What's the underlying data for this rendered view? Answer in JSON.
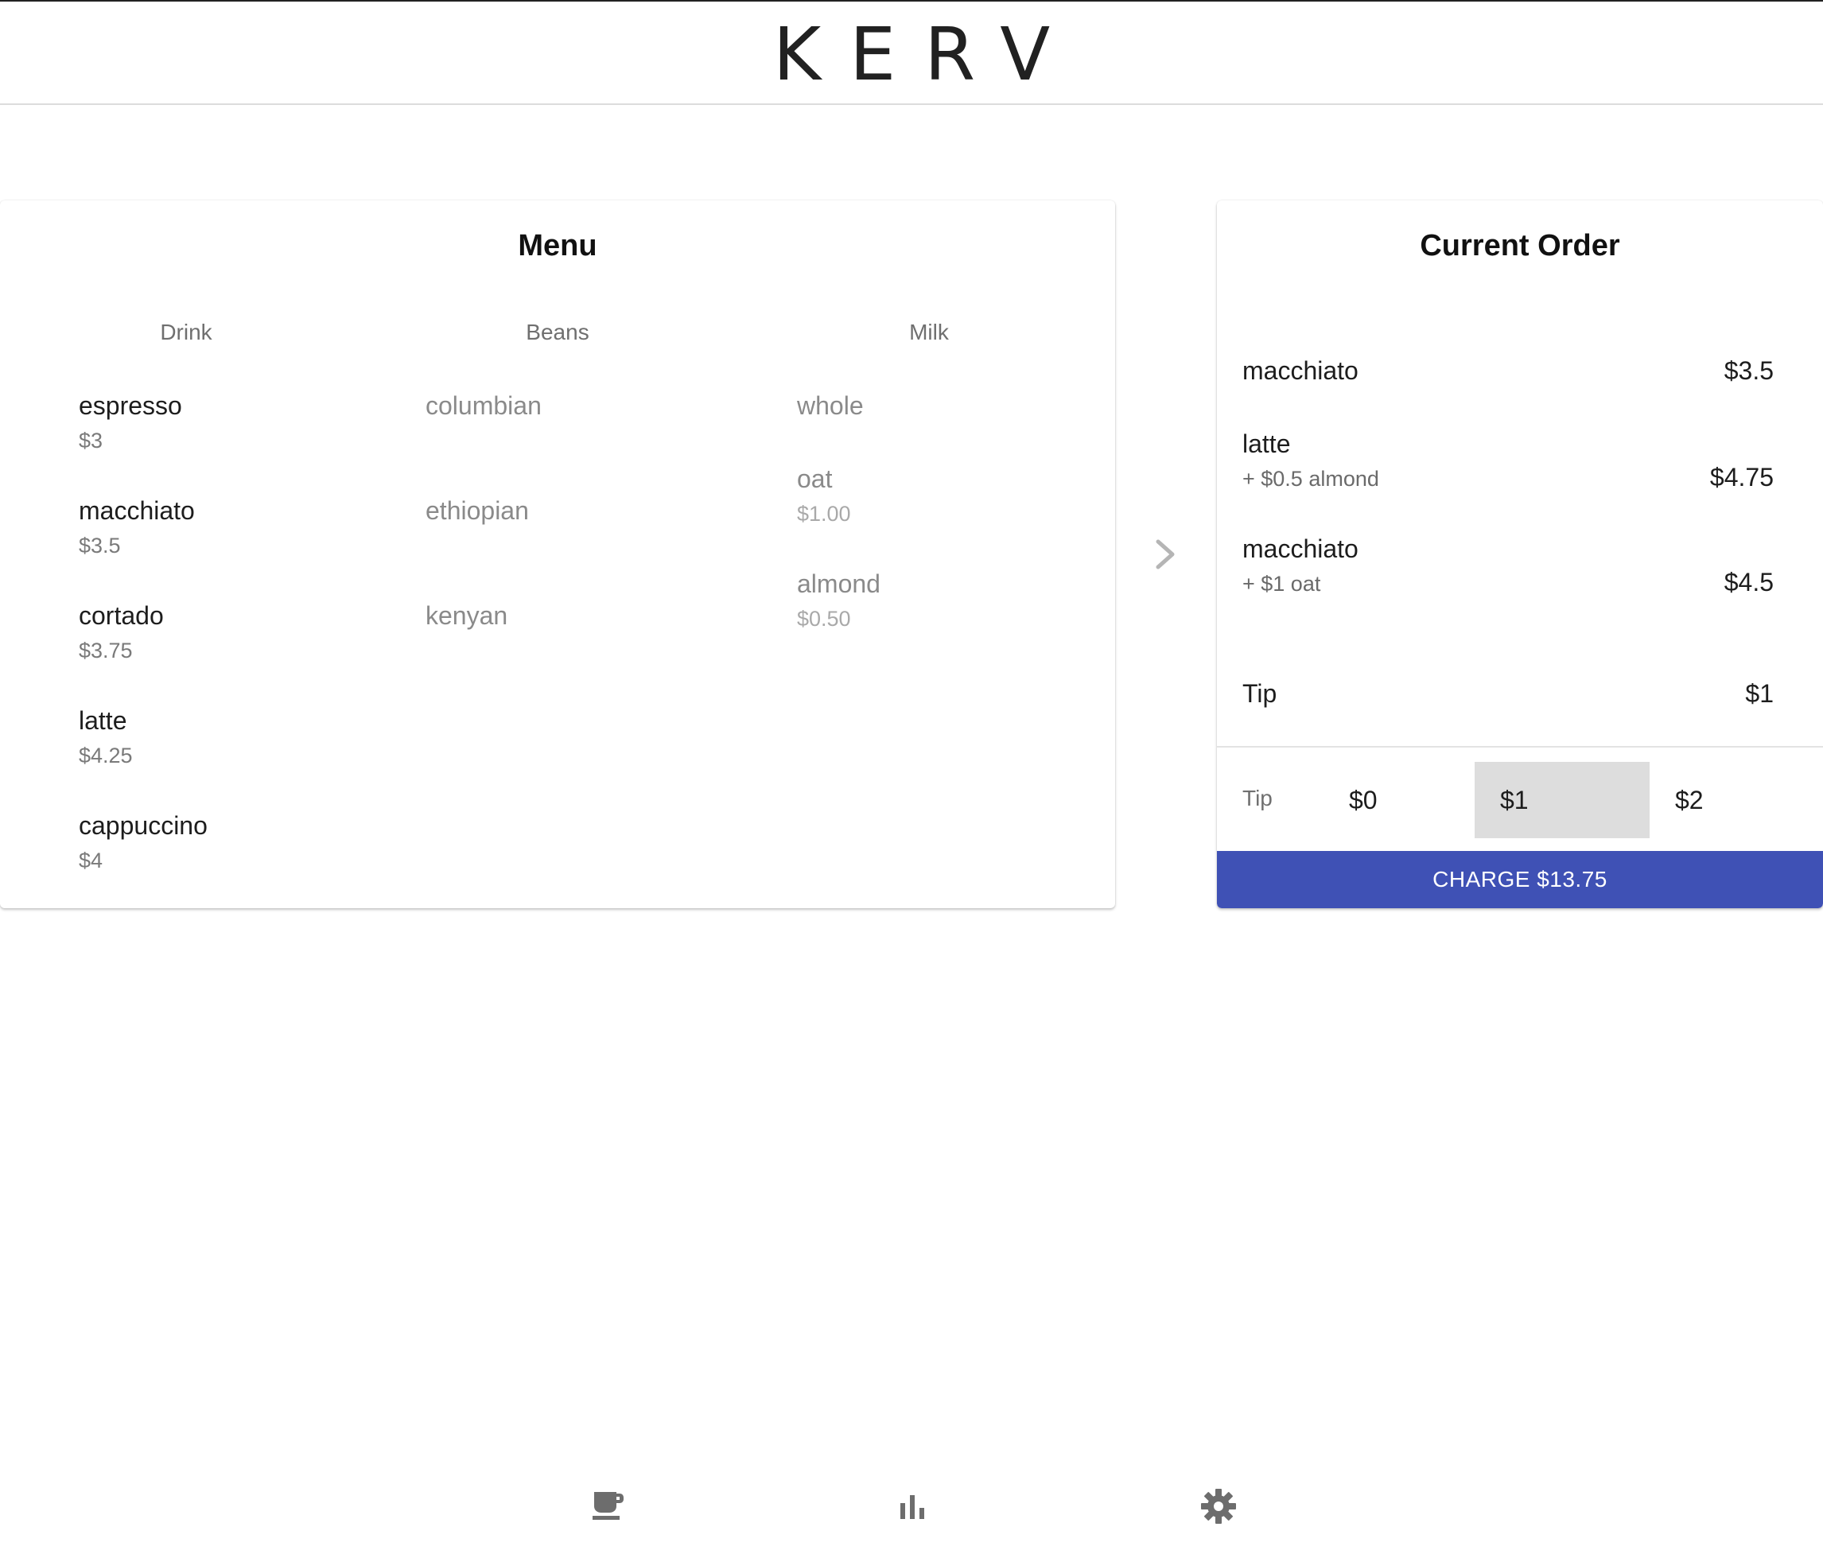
{
  "app": {
    "logo": "KERV"
  },
  "menu": {
    "title": "Menu",
    "columns": {
      "drink": "Drink",
      "beans": "Beans",
      "milk": "Milk"
    },
    "drinks": [
      {
        "name": "espresso",
        "price": "$3"
      },
      {
        "name": "macchiato",
        "price": "$3.5"
      },
      {
        "name": "cortado",
        "price": "$3.75"
      },
      {
        "name": "latte",
        "price": "$4.25"
      },
      {
        "name": "cappuccino",
        "price": "$4"
      }
    ],
    "beans": [
      {
        "name": "columbian"
      },
      {
        "name": "ethiopian"
      },
      {
        "name": "kenyan"
      }
    ],
    "milks": [
      {
        "name": "whole"
      },
      {
        "name": "oat",
        "price": "$1.00"
      },
      {
        "name": "almond",
        "price": "$0.50"
      }
    ]
  },
  "order": {
    "title": "Current Order",
    "items": [
      {
        "name": "macchiato",
        "addon": "",
        "price": "$3.5"
      },
      {
        "name": "latte",
        "addon": "+ $0.5 almond",
        "price": "$4.75"
      },
      {
        "name": "macchiato",
        "addon": "+ $1 oat",
        "price": "$4.5"
      }
    ],
    "tip_row": {
      "label": "Tip",
      "value": "$1"
    },
    "tip_selector": {
      "label": "Tip",
      "options": [
        "$0",
        "$1",
        "$2"
      ],
      "selected": "$1"
    },
    "charge_label": "CHARGE $13.75"
  },
  "bottom_nav": {
    "icons": [
      "coffee-cup-icon",
      "bar-chart-icon",
      "gear-icon"
    ],
    "active": "coffee-cup-icon"
  },
  "colors": {
    "accent": "#3f51b5",
    "selected_tip_bg": "#dddddd",
    "icon_gray": "#6d6d6d"
  }
}
